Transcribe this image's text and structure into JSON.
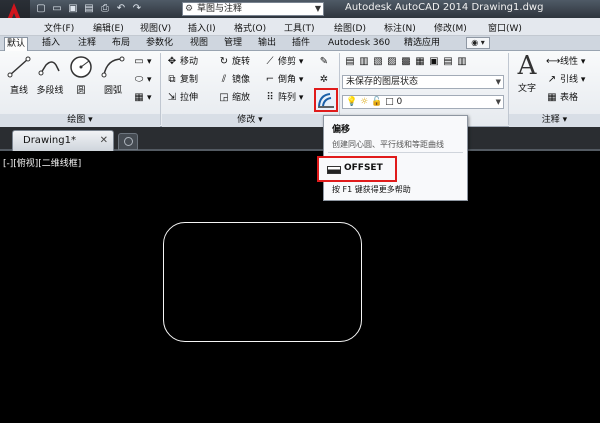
{
  "titlebar": {
    "workspace": "草图与注释",
    "title": "Autodesk AutoCAD 2014    Drawing1.dwg"
  },
  "quick_access": [
    "new-icon",
    "open-icon",
    "save-icon",
    "saveas-icon",
    "plot-icon",
    "undo-icon",
    "redo-icon"
  ],
  "menu": {
    "items": [
      "文件(F)",
      "编辑(E)",
      "视图(V)",
      "插入(I)",
      "格式(O)",
      "工具(T)",
      "绘图(D)",
      "标注(N)",
      "修改(M)",
      "窗口(W)"
    ]
  },
  "ribbon_tabs": {
    "items": [
      "默认",
      "插入",
      "注释",
      "布局",
      "参数化",
      "视图",
      "管理",
      "输出",
      "插件",
      "Autodesk 360",
      "精选应用"
    ]
  },
  "ribbon": {
    "draw": {
      "title": "绘图",
      "line": "直线",
      "polyline": "多段线",
      "circle": "圆",
      "arc": "圆弧"
    },
    "modify": {
      "title": "修改",
      "move": "移动",
      "rotate": "旋转",
      "trim": "修剪",
      "copy": "复制",
      "mirror": "镜像",
      "fillet": "倒角",
      "stretch": "拉伸",
      "scale": "缩放",
      "array": "阵列"
    },
    "layers": {
      "state": "未保存的图层状态",
      "current": "0"
    },
    "annotation": {
      "title": "注释",
      "text": "文字",
      "linear": "线性",
      "leader": "引线",
      "table": "表格"
    }
  },
  "document": {
    "tab_name": "Drawing1*"
  },
  "viewport": {
    "label": "[-][俯视][二维线框]"
  },
  "tooltip": {
    "title": "偏移",
    "description": "创建同心圆、平行线和等距曲线",
    "command": "OFFSET",
    "help": "按 F1 键获得更多帮助"
  },
  "colors": {
    "highlight": "#e01b1b",
    "canvas": "#000000"
  }
}
